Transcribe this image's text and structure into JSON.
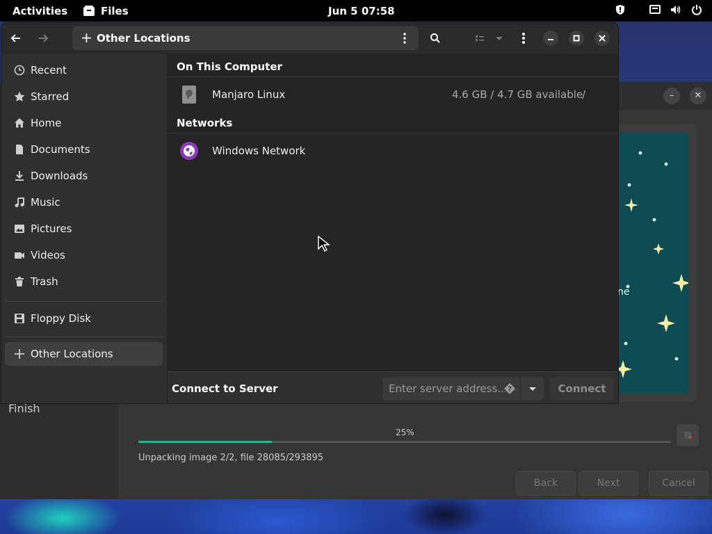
{
  "topbar": {
    "activities": "Activities",
    "app_name": "Files",
    "clock": "Jun 5  07:58"
  },
  "files_window": {
    "location_label": "Other Locations",
    "sidebar": {
      "items": [
        {
          "label": "Recent",
          "icon": "clock-icon"
        },
        {
          "label": "Starred",
          "icon": "star-icon"
        },
        {
          "label": "Home",
          "icon": "home-icon"
        },
        {
          "label": "Documents",
          "icon": "document-icon"
        },
        {
          "label": "Downloads",
          "icon": "download-icon"
        },
        {
          "label": "Music",
          "icon": "music-icon"
        },
        {
          "label": "Pictures",
          "icon": "picture-icon"
        },
        {
          "label": "Videos",
          "icon": "video-icon"
        },
        {
          "label": "Trash",
          "icon": "trash-icon"
        }
      ],
      "devices": [
        {
          "label": "Floppy Disk",
          "icon": "floppy-icon"
        }
      ],
      "other_locations": "Other Locations"
    },
    "sections": {
      "on_this_computer": "On This Computer",
      "networks": "Networks"
    },
    "computer_items": [
      {
        "name": "Manjaro Linux",
        "available": "4.6 GB / 4.7 GB available",
        "mount": "/"
      }
    ],
    "network_items": [
      {
        "name": "Windows Network"
      }
    ],
    "connect": {
      "title": "Connect to Server",
      "placeholder": "Enter server address...",
      "button": "Connect"
    }
  },
  "installer": {
    "sidebar_step": "Finish",
    "slide_text": "ne",
    "progress_text": "25%",
    "progress": 0.25,
    "status": "Unpacking image 2/2, file 28085/293895",
    "buttons": {
      "back": "Back",
      "next": "Next",
      "cancel": "Cancel"
    }
  },
  "colors": {
    "accent_progress": "#2eb398",
    "window_bg": "#242424",
    "sidebar_bg": "#2f2f2f"
  }
}
